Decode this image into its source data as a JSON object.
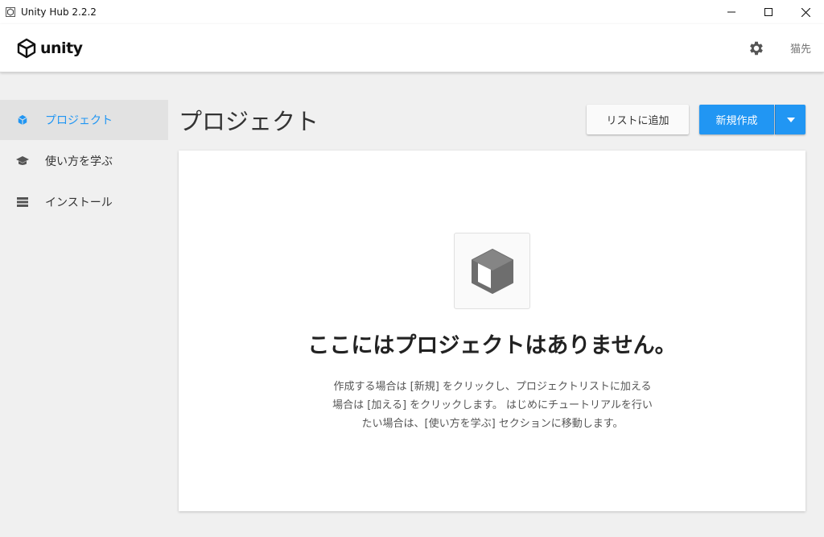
{
  "window": {
    "title": "Unity Hub 2.2.2"
  },
  "header": {
    "logo_text": "unity",
    "username": "猫先"
  },
  "sidebar": {
    "items": [
      {
        "label": "プロジェクト",
        "icon": "cube-icon",
        "active": true
      },
      {
        "label": "使い方を学ぶ",
        "icon": "graduation-cap-icon",
        "active": false
      },
      {
        "label": "インストール",
        "icon": "list-icon",
        "active": false
      }
    ]
  },
  "main": {
    "title": "プロジェクト",
    "add_button": "リストに追加",
    "new_button": "新規作成",
    "empty": {
      "title": "ここにはプロジェクトはありません。",
      "desc_line1": "作成する場合は [新規] をクリックし、プロジェクトリストに加える",
      "desc_line2": "場合は [加える] をクリックします。 はじめにチュートリアルを行い",
      "desc_line3": "たい場合は、[使い方を学ぶ] セクションに移動します。"
    }
  },
  "colors": {
    "accent": "#2196f3",
    "background": "#f0f0f0",
    "panel": "#ffffff"
  }
}
